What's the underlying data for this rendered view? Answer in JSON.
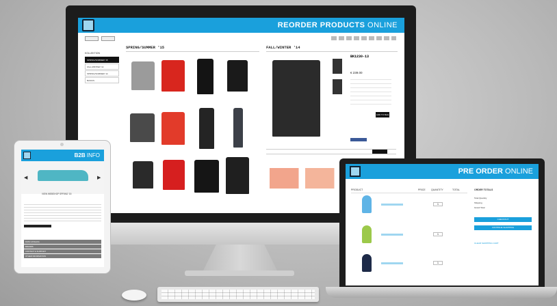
{
  "imac": {
    "title_bold": "REORDER PRODUCTS",
    "title_light": " ONLINE",
    "sidebar": {
      "category_label": "KOLLEKTION",
      "items": [
        "SPRING/SOMMER '15",
        "FALL/WINTER '14",
        "SPRING/SOMMER '14",
        "BASICS"
      ]
    },
    "col1_title": "SPRING/SUMMER '15",
    "col2_title": "FALL/WINTER '14",
    "product": {
      "code": "BK1230-13",
      "price": "€ 239.00",
      "add_label": "ADD TO BAG"
    }
  },
  "tablet": {
    "title_bold": "B2B",
    "title_light": " INFO",
    "caption": "VIEW WEBSHOP SPRING '15",
    "rows": [
      "DATA CATALOG",
      "BRANDS",
      "CONTACT & SUPPORT",
      "OTHER INFORMATION"
    ]
  },
  "laptop": {
    "title_bold": "PRE ORDER",
    "title_light": " ONLINE",
    "columns": [
      "PRODUCT",
      "PRICE",
      "QUANTITY",
      "TOTAL"
    ],
    "summary_title": "ORDER TOTALS",
    "summary_lines": [
      "Total Quantity",
      "Shipping",
      "Grand Total"
    ],
    "checkout_label": "CHECKOUT",
    "continue_label": "CONTINUE SHOPPING",
    "clear_label": "CLEAR SHOPPING CART",
    "quantities": [
      "1",
      "1",
      "1"
    ]
  },
  "colors": {
    "accent": "#1aa0dc",
    "chair_blue": "#5fb4e6",
    "chair_green": "#9cc94a",
    "chair_navy": "#1d2a48"
  }
}
